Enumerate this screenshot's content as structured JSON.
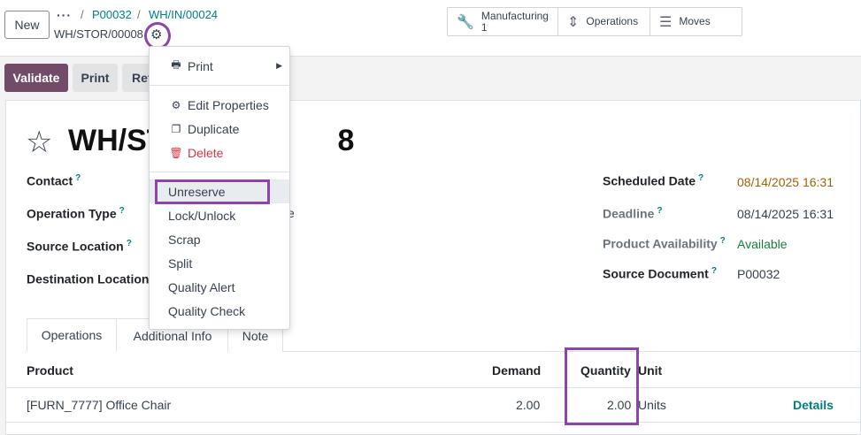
{
  "header": {
    "new_label": "New",
    "breadcrumb_dots": "···",
    "breadcrumb": [
      "P00032",
      "WH/IN/00024"
    ],
    "record_name": "WH/STOR/00008"
  },
  "smart_buttons": [
    {
      "icon": "wrench-icon",
      "label": "Manufacturing",
      "count": "1"
    },
    {
      "icon": "updown-arrows-icon",
      "label": "Operations"
    },
    {
      "icon": "list-icon",
      "label": "Moves"
    }
  ],
  "actions": {
    "validate": "Validate",
    "print": "Print",
    "return": "Return"
  },
  "form": {
    "title_prefix": "WH/ST",
    "title_suffix": "8",
    "left_fields": [
      {
        "label": "Contact",
        "value": ""
      },
      {
        "label": "Operation Type",
        "value": "e"
      },
      {
        "label": "Source Location",
        "value": ""
      },
      {
        "label": "Destination Location",
        "value": ""
      }
    ],
    "right_fields": [
      {
        "label": "Scheduled Date",
        "value": "08/14/2025 16:31"
      },
      {
        "label": "Deadline",
        "value": "08/14/2025 16:31"
      },
      {
        "label": "Product Availability",
        "value": "Available"
      },
      {
        "label": "Source Document",
        "value": "P00032"
      }
    ],
    "help_mark": "?"
  },
  "tabs": [
    "Operations",
    "Additional Info",
    "Note"
  ],
  "table": {
    "headers": {
      "product": "Product",
      "demand": "Demand",
      "quantity": "Quantity",
      "unit": "Unit"
    },
    "rows": [
      {
        "product": "[FURN_7777] Office Chair",
        "demand": "2.00",
        "quantity": "2.00",
        "unit": "Units",
        "details": "Details"
      }
    ]
  },
  "menu": {
    "print": "Print",
    "edit_properties": "Edit Properties",
    "duplicate": "Duplicate",
    "delete": "Delete",
    "unreserve": "Unreserve",
    "lock_unlock": "Lock/Unlock",
    "scrap": "Scrap",
    "split": "Split",
    "quality_alert": "Quality Alert",
    "quality_check": "Quality Check"
  },
  "colors": {
    "primary": "#714b67",
    "link": "#017e84",
    "highlight": "#8e44ad",
    "danger": "#dc3545"
  }
}
